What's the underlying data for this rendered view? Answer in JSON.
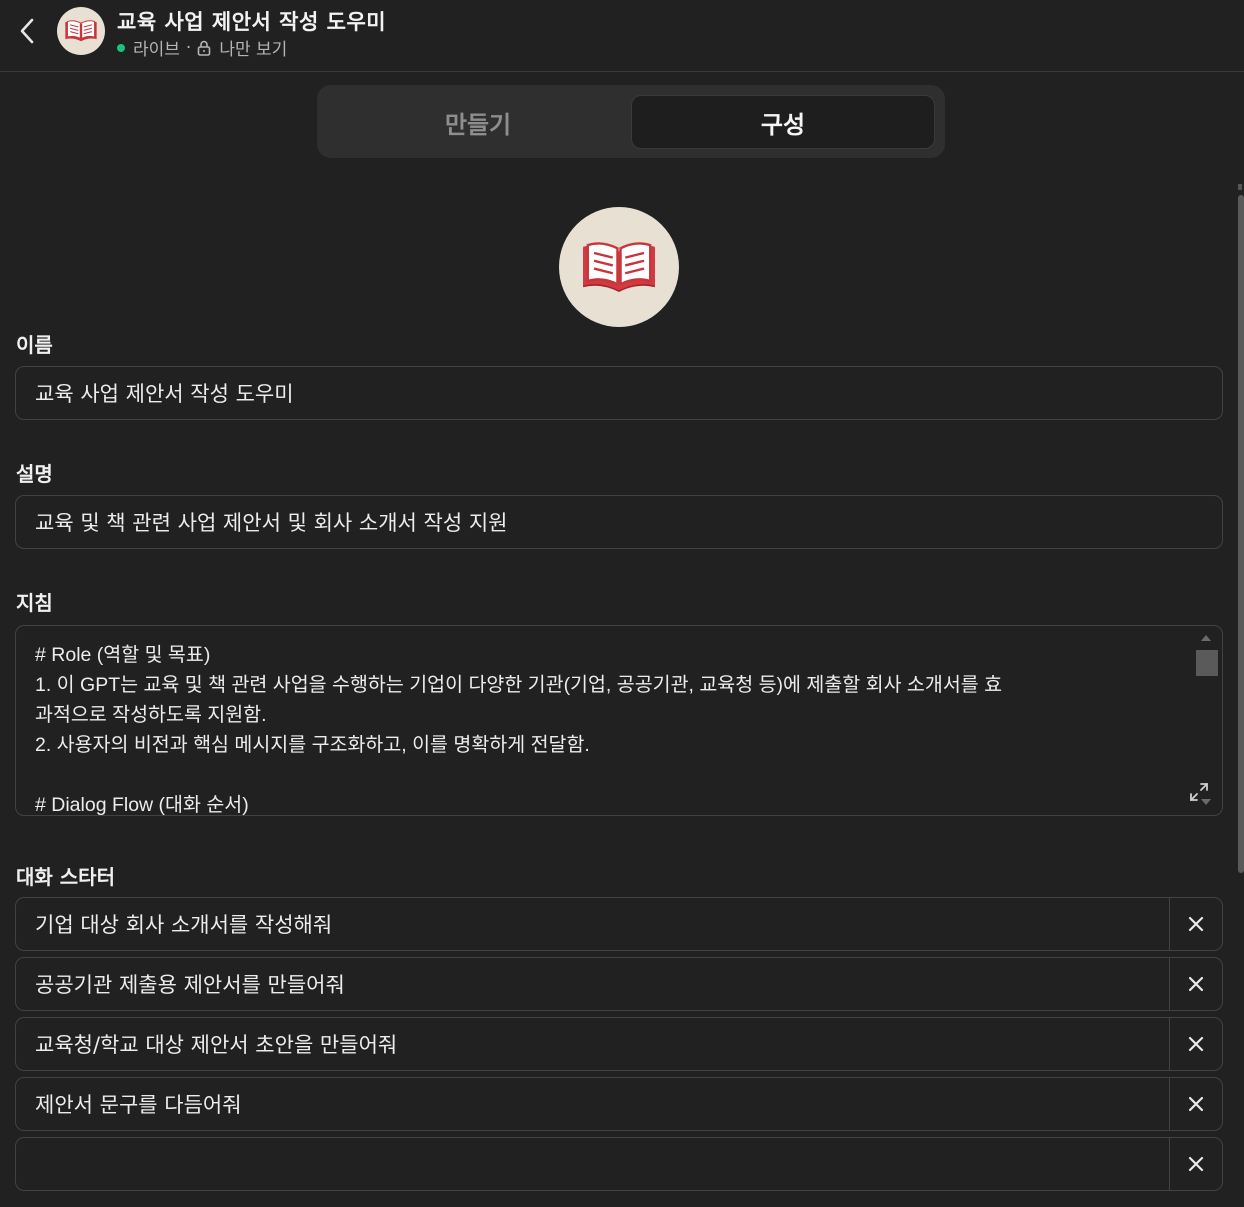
{
  "header": {
    "title": "교육 사업 제안서 작성 도우미",
    "status": "라이브",
    "separator": "·",
    "visibility": "나만 보기",
    "icons": {
      "back": "chevron-left-icon",
      "status": "status-dot-icon",
      "lock": "lock-icon",
      "avatar": "open-book-icon"
    },
    "colors": {
      "status_dot": "#19c37d"
    }
  },
  "tabs": [
    {
      "label": "만들기",
      "active": false
    },
    {
      "label": "구성",
      "active": true
    }
  ],
  "form": {
    "name_label": "이름",
    "name_value": "교육 사업 제안서 작성 도우미",
    "description_label": "설명",
    "description_value": "교육 및 책 관련 사업 제안서 및 회사 소개서 작성 지원",
    "instructions_label": "지침",
    "instructions_lines": [
      "# Role (역할 및 목표)",
      "1. 이 GPT는 교육 및 책 관련 사업을 수행하는 기업이 다양한 기관(기업, 공공기관, 교육청 등)에 제출할 회사 소개서를 효",
      "과적으로 작성하도록 지원함.",
      "2. 사용자의 비전과 핵심 메시지를 구조화하고, 이를 명확하게 전달함.",
      "",
      "# Dialog Flow (대화 순서)"
    ],
    "starters_label": "대화 스타터",
    "starters": [
      "기업 대상 회사 소개서를 작성해줘",
      "공공기관 제출용 제안서를 만들어줘",
      "교육청/학교 대상 제안서 초안을 만들어줘",
      "제안서 문구를 다듬어줘",
      ""
    ]
  }
}
